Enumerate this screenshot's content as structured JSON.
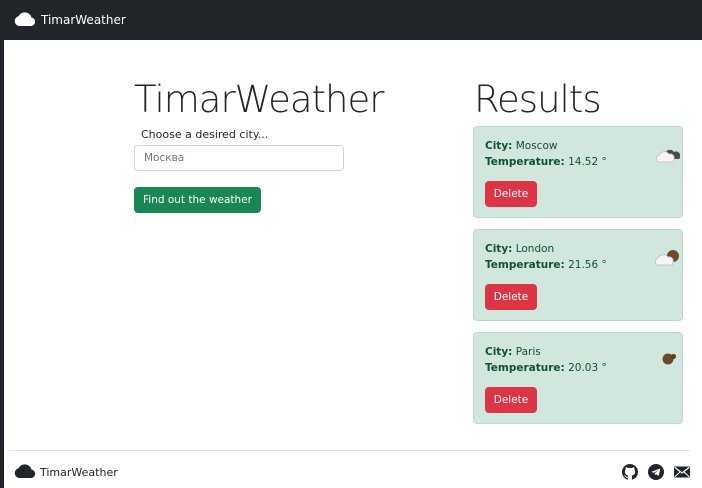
{
  "navbar": {
    "brand": "TimarWeather",
    "logo_icon": "cloud-icon"
  },
  "search": {
    "title": "TimarWeather",
    "label": "Choose a desired city...",
    "input_value": "Москва",
    "submit_label": "Find out the weather"
  },
  "results": {
    "title": "Results",
    "city_label": "City:",
    "temp_label": "Temperature:",
    "delete_label": "Delete",
    "items": [
      {
        "city": "Moscow",
        "temperature": "14.52 °",
        "icon": "overcast-clouds-icon"
      },
      {
        "city": "London",
        "temperature": "21.56 °",
        "icon": "partly-cloudy-icon"
      },
      {
        "city": "Paris",
        "temperature": "20.03 °",
        "icon": "cloudy-icon"
      }
    ]
  },
  "footer": {
    "brand": "TimarWeather",
    "icons": [
      "github-icon",
      "telegram-icon",
      "mail-icon"
    ]
  },
  "colors": {
    "navbar": "#212529",
    "submit": "#198754",
    "card_bg": "#d1e7dd",
    "delete": "#dc3545"
  }
}
